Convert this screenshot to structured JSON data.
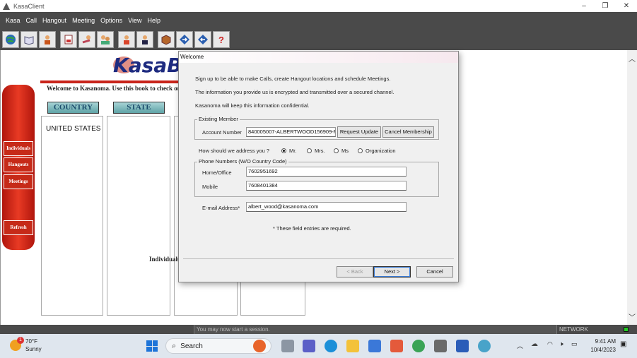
{
  "window": {
    "title": "KasaClient",
    "minimize": "–",
    "maximize": "❐",
    "close": "✕"
  },
  "menu": [
    "Kasa",
    "Call",
    "Hangout",
    "Meeting",
    "Options",
    "View",
    "Help"
  ],
  "toolbar_icons": [
    "globe-icon",
    "book-icon",
    "person-icon",
    "phone-list-icon",
    "handshake-icon",
    "group-icon",
    "user-icon",
    "user-dark-icon",
    "box-icon",
    "arrow-right-icon",
    "arrow-left-icon",
    "help-icon"
  ],
  "page": {
    "logo": "KasaBo",
    "welcome": "Welcome to Kasanoma. Use this book to check on",
    "tabs": {
      "country": "COUNTRY",
      "state": "STATE"
    },
    "country_item": "UNITED STATES",
    "individuals_label": "Individuals",
    "sidebar": [
      "Individuals",
      "Hangouts",
      "Meetings",
      "Refresh"
    ]
  },
  "dialog": {
    "title": "Welcome",
    "intro1": "Sign up to be able to make Calls, create Hangout locations and schedule Meetings.",
    "intro2": "The information you provide us is encrypted and transmitted over a secured channel.",
    "intro3": "Kasanoma will keep this information confidential.",
    "existing_member": "Existing Member",
    "account_label": "Account Number",
    "account_value": "840005007-ALBERTWOOD156909-F",
    "request_update": "Request Update",
    "cancel_membership": "Cancel Membership",
    "address_question": "How should we address you ?",
    "salutations": [
      {
        "label": "Mr.",
        "selected": true
      },
      {
        "label": "Mrs.",
        "selected": false
      },
      {
        "label": "Ms",
        "selected": false
      },
      {
        "label": "Organization",
        "selected": false
      }
    ],
    "phone_group": "Phone Numbers (W/O Country Code)",
    "home_label": "Home/Office",
    "home_value": "7602951692",
    "mobile_label": "Mobile",
    "mobile_value": "7608401384",
    "email_label": "E-mail Address*",
    "email_value": "albert_wood@kasanoma.com",
    "required_note": "* These field entries are required.",
    "back": "< Back",
    "next": "Next >",
    "cancel": "Cancel"
  },
  "status": {
    "message": "You may now start a session.",
    "network": "NETWORK"
  },
  "taskbar": {
    "temp": "70°F",
    "condition": "Sunny",
    "weather_badge": "1",
    "search": "Search",
    "time": "9:41 AM",
    "date": "10/4/2023"
  }
}
